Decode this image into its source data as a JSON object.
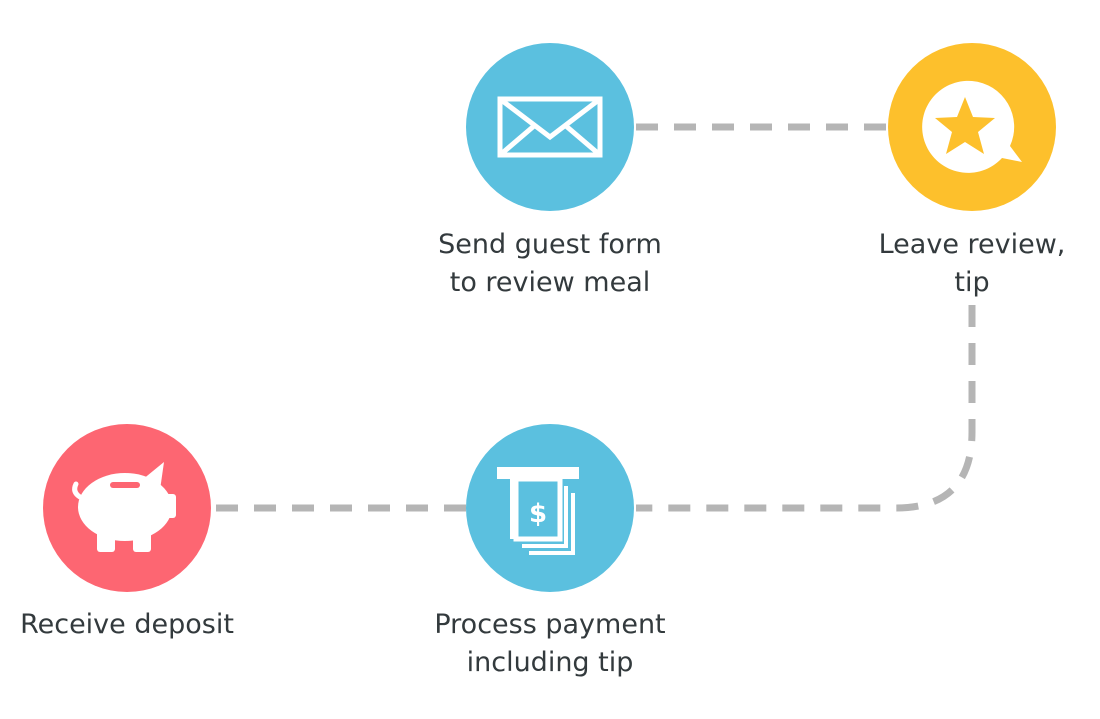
{
  "colors": {
    "blue": "#5bc0df",
    "yellow": "#fdc02c",
    "red": "#fd6672",
    "connector": "#b5b5b5",
    "text": "#333a3d"
  },
  "steps": [
    {
      "icon": "envelope-icon",
      "color": "#5bc0df",
      "lines": [
        "Send guest form",
        "to review meal"
      ]
    },
    {
      "icon": "star-chat-icon",
      "color": "#fdc02c",
      "lines": [
        "Leave review,",
        "tip"
      ]
    },
    {
      "icon": "atm-dollar-icon",
      "color": "#5bc0df",
      "lines": [
        "Process payment",
        "including tip"
      ]
    },
    {
      "icon": "piggy-bank-icon",
      "color": "#fd6672",
      "lines": [
        "Receive deposit"
      ]
    }
  ],
  "labels": {
    "send_line1": "Send guest form",
    "send_line2": "to review meal",
    "review_line1": "Leave review,",
    "review_line2": "tip",
    "process_line1": "Process payment",
    "process_line2": "including tip",
    "deposit_line1": "Receive deposit"
  }
}
